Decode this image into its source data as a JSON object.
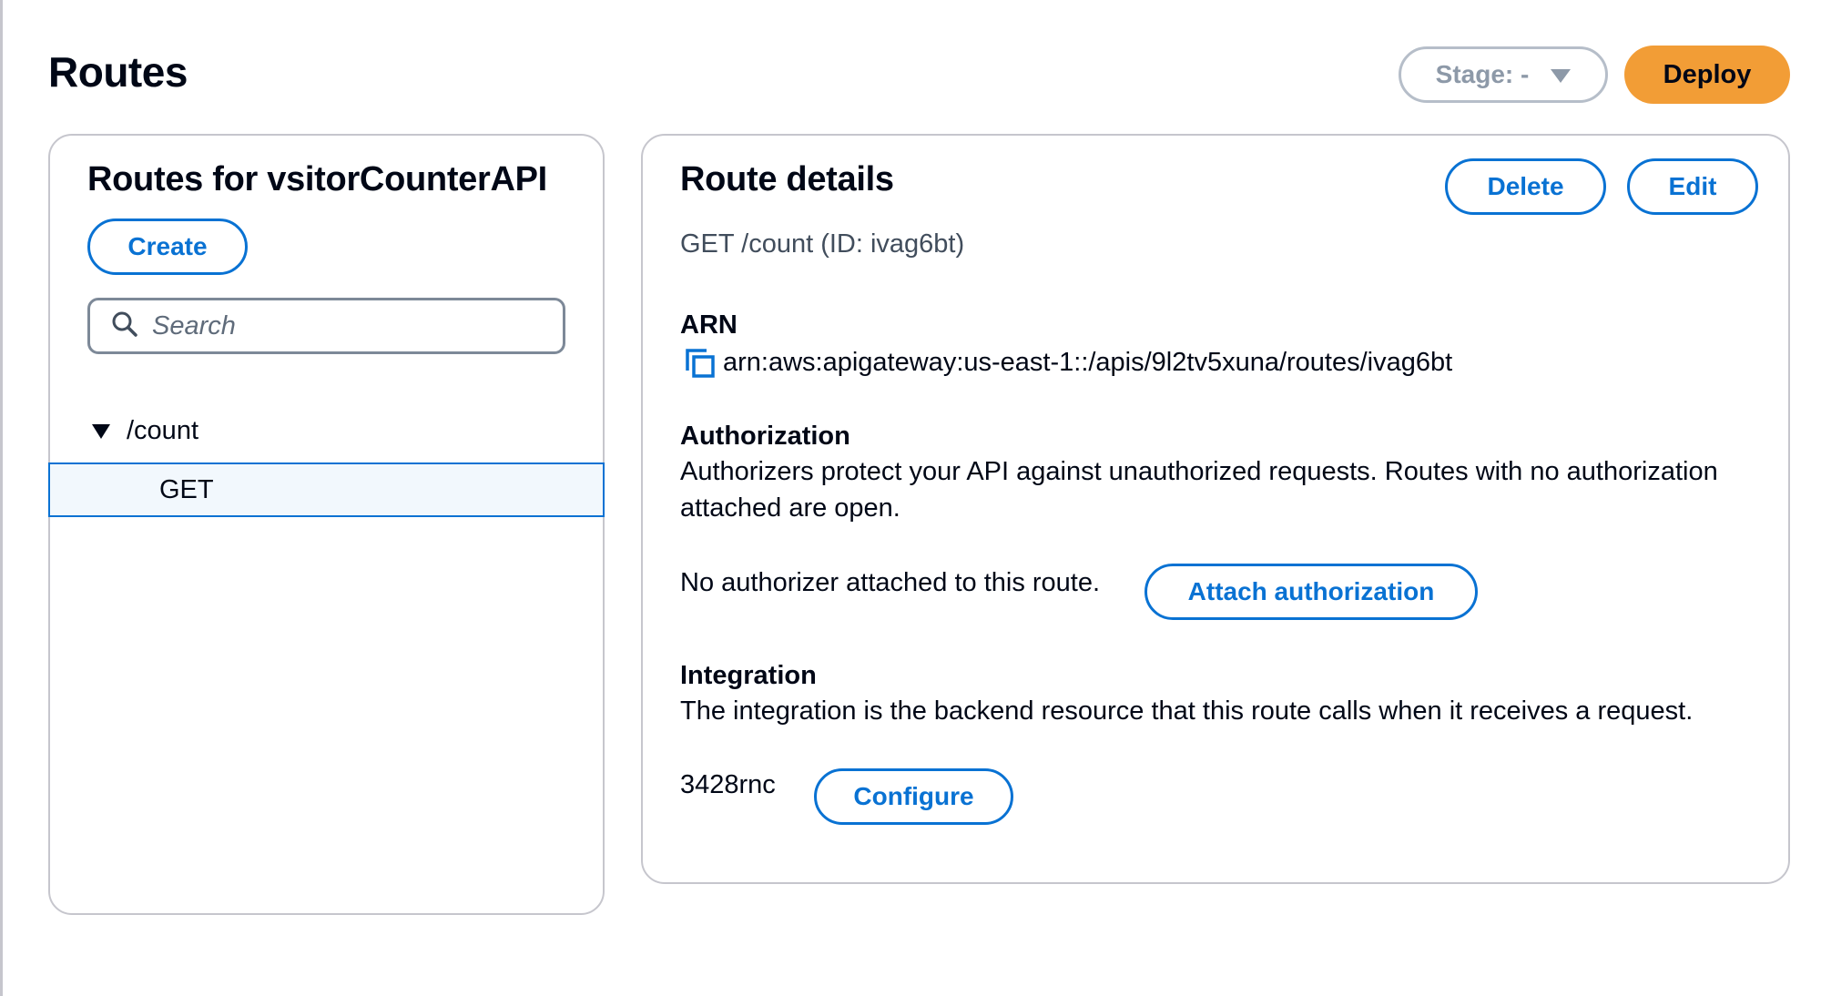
{
  "page": {
    "title": "Routes",
    "stage_label": "Stage: -",
    "deploy_label": "Deploy"
  },
  "routes_panel": {
    "title": "Routes for vsitorCounterAPI",
    "create_label": "Create",
    "search_placeholder": "Search",
    "tree": [
      {
        "resource": "/count",
        "methods": [
          "GET"
        ]
      }
    ]
  },
  "route_details": {
    "title": "Route details",
    "delete_label": "Delete",
    "edit_label": "Edit",
    "subtitle": "GET /count (ID: ivag6bt)",
    "arn_heading": "ARN",
    "arn_value": "arn:aws:apigateway:us-east-1::/apis/9l2tv5xuna/routes/ivag6bt",
    "authorization_heading": "Authorization",
    "authorization_desc": "Authorizers protect your API against unauthorized requests. Routes with no authorization attached are open.",
    "authorization_status": "No authorizer attached to this route.",
    "attach_authorization_label": "Attach authorization",
    "integration_heading": "Integration",
    "integration_desc": "The integration is the backend resource that this route calls when it receives a request.",
    "integration_id": "3428rnc",
    "configure_label": "Configure"
  },
  "colors": {
    "accent_blue": "#0972d3",
    "deploy_orange": "#f29d36",
    "selected_bg": "#f2f8fd",
    "border_gray": "#c6c6cd"
  },
  "icons": {
    "search": "search-icon",
    "copy": "copy-icon",
    "stage_caret": "caret-down-icon",
    "tree_caret": "caret-down-icon"
  }
}
